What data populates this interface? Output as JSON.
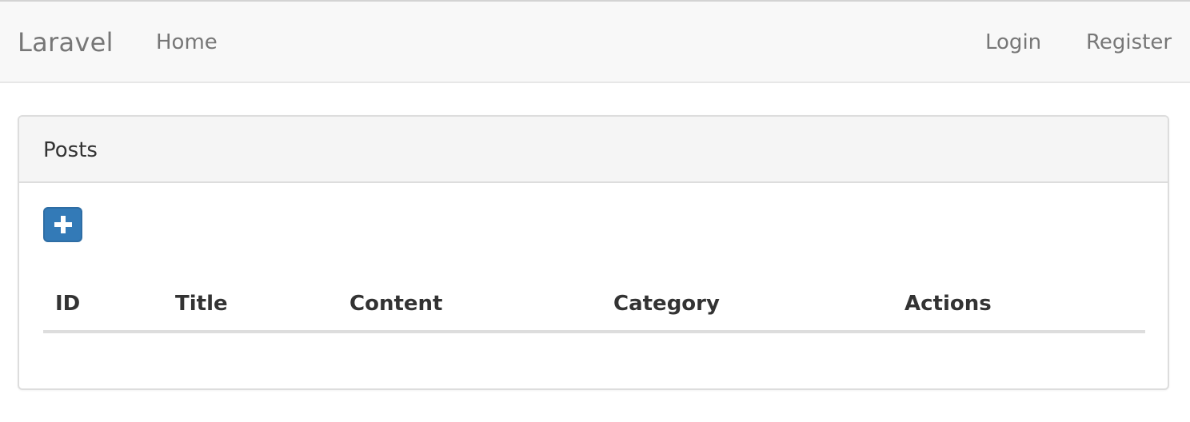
{
  "navbar": {
    "brand": "Laravel",
    "left_links": [
      {
        "label": "Home"
      }
    ],
    "right_links": [
      {
        "label": "Login"
      },
      {
        "label": "Register"
      }
    ]
  },
  "panel": {
    "title": "Posts",
    "add_button": {
      "icon": "plus-icon",
      "color": "#337ab7"
    },
    "table": {
      "columns": [
        "ID",
        "Title",
        "Content",
        "Category",
        "Actions"
      ],
      "rows": []
    }
  }
}
